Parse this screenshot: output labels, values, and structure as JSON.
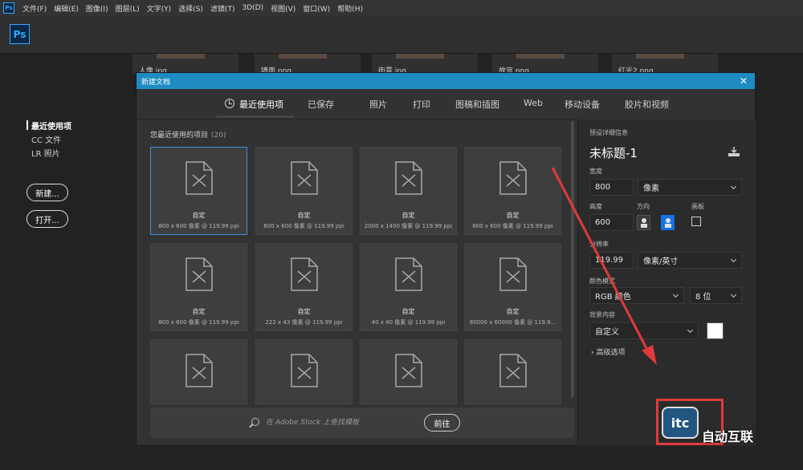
{
  "menubar": {
    "app_icon": "Ps",
    "items": [
      "文件(F)",
      "编辑(E)",
      "图像(I)",
      "图层(L)",
      "文字(Y)",
      "选择(S)",
      "滤镜(T)",
      "3D(D)",
      "视图(V)",
      "窗口(W)",
      "帮助(H)"
    ]
  },
  "appbar": {
    "logo": "Ps"
  },
  "home": {
    "nav": [
      "最近使用项",
      "CC 文件",
      "LR 照片"
    ],
    "new_button": "新建...",
    "open_button": "打开..."
  },
  "background_thumbs": [
    "人像.jpg",
    "墙面.png",
    "街景.jpg",
    "故宫.png",
    "红光2.png"
  ],
  "dialog": {
    "title": "新建文档",
    "close_glyph": "✕",
    "tabs": [
      "最近使用项",
      "已保存",
      "照片",
      "打印",
      "图稿和插图",
      "Web",
      "移动设备",
      "胶片和视频"
    ],
    "active_tab": "最近使用项",
    "recent_heading": "您最近使用的项目",
    "recent_count": "(20)",
    "presets": [
      {
        "name": "自定",
        "size": "800 x 600 像素 @ 119.99 ppi"
      },
      {
        "name": "自定",
        "size": "600 x 600 像素 @ 119.99 ppi"
      },
      {
        "name": "自定",
        "size": "2000 x 1400 像素 @ 119.99 ppi"
      },
      {
        "name": "自定",
        "size": "800 x 600 像素 @ 119.99 ppi"
      },
      {
        "name": "自定",
        "size": "800 x 600 像素 @ 119.99 ppi"
      },
      {
        "name": "自定",
        "size": "222 x 43 像素 @ 119.99 ppi"
      },
      {
        "name": "自定",
        "size": "40 x 40 像素 @ 119.99 ppi"
      },
      {
        "name": "自定",
        "size": "80000 x 60000 像素 @ 119.9..."
      },
      {
        "name": "",
        "size": ""
      },
      {
        "name": "",
        "size": ""
      },
      {
        "name": "",
        "size": ""
      },
      {
        "name": "",
        "size": ""
      }
    ],
    "stock_placeholder": "在 Adobe Stock 上查找模板",
    "go_button": "前往"
  },
  "preset_details": {
    "heading": "预设详细信息",
    "doc_name": "未标题-1",
    "width_label": "宽度",
    "width_value": "800",
    "width_unit": "像素",
    "height_label": "高度",
    "height_value": "600",
    "orientation_label": "方向",
    "artboard_label": "画板",
    "resolution_label": "分辨率",
    "resolution_value": "119.99",
    "resolution_unit": "像素/英寸",
    "color_mode_label": "颜色模式",
    "color_mode_value": "RGB 颜色",
    "bit_depth": "8 位",
    "background_label": "背景内容",
    "background_value": "自定义",
    "background_color": "#ffffff",
    "advanced": "高级选项"
  },
  "watermark": {
    "badge": "itc",
    "text": "自动互联"
  },
  "colors": {
    "dialog_title_bar": "#1e8bc3",
    "annotation_red": "#e03a3a",
    "selection_blue": "#3b8fe0"
  }
}
